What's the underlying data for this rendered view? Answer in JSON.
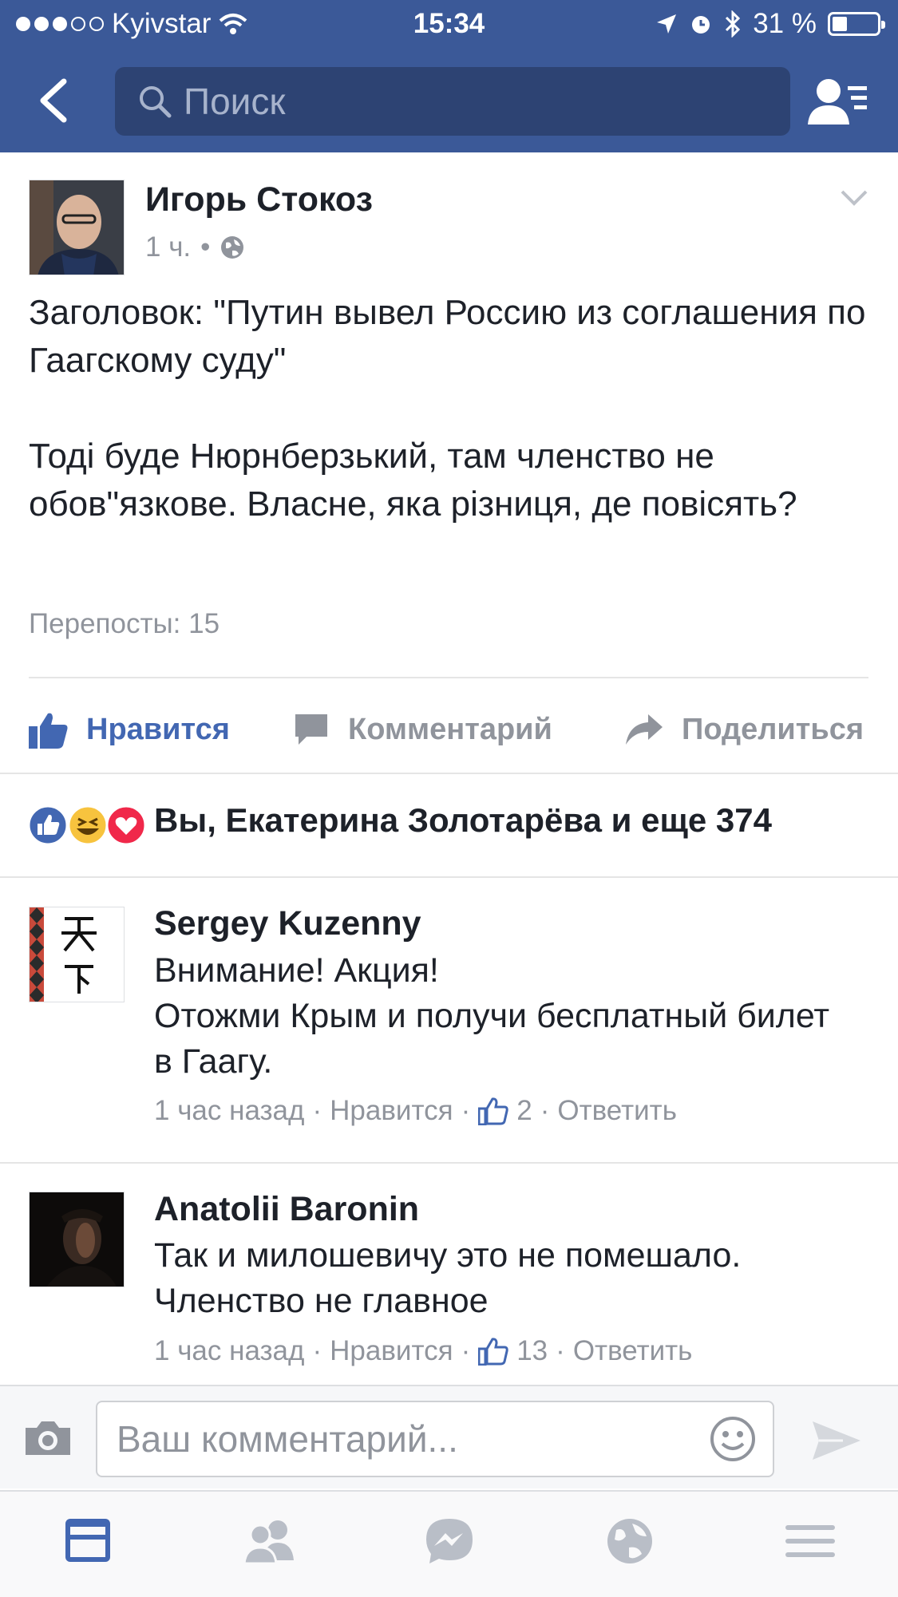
{
  "status_bar": {
    "carrier": "Kyivstar",
    "time": "15:34",
    "battery": "31 %"
  },
  "nav": {
    "search_placeholder": "Поиск"
  },
  "post": {
    "author": "Игорь Стокоз",
    "time": "1 ч.",
    "paragraphs": [
      "Заголовок: \"Путин вывел Россию из соглашения по Гаагскому суду\"",
      "Тоді буде Нюрнберзький, там членство не обов\"язкове. Власне, яка різниця, де повісять?"
    ],
    "reposts": "Перепосты: 15",
    "actions": {
      "like": "Нравится",
      "comment": "Комментарий",
      "share": "Поделиться"
    },
    "reactions_text": "Вы, Екатерина Золотарёва и еще 374"
  },
  "comments": [
    {
      "name": "Sergey Kuzenny",
      "text": "Внимание! Акция!\nОтожми Крым и получи бесплатный билет в Гаагу.",
      "time": "1 час назад",
      "like": "Нравится",
      "likes": "2",
      "reply": "Ответить"
    },
    {
      "name": "Anatolii Baronin",
      "text": "Так и милошевичу это не помешало. Членство не главное",
      "time": "1 час назад",
      "like": "Нравится",
      "likes": "13",
      "reply": "Ответить"
    }
  ],
  "composer": {
    "placeholder": "Ваш комментарий..."
  },
  "colors": {
    "brand": "#3b5998",
    "like_blue": "#4267b2",
    "meta_gray": "#90949c"
  },
  "tabs": [
    "news-feed",
    "friends",
    "messenger",
    "notifications",
    "menu"
  ],
  "active_tab": "news-feed"
}
